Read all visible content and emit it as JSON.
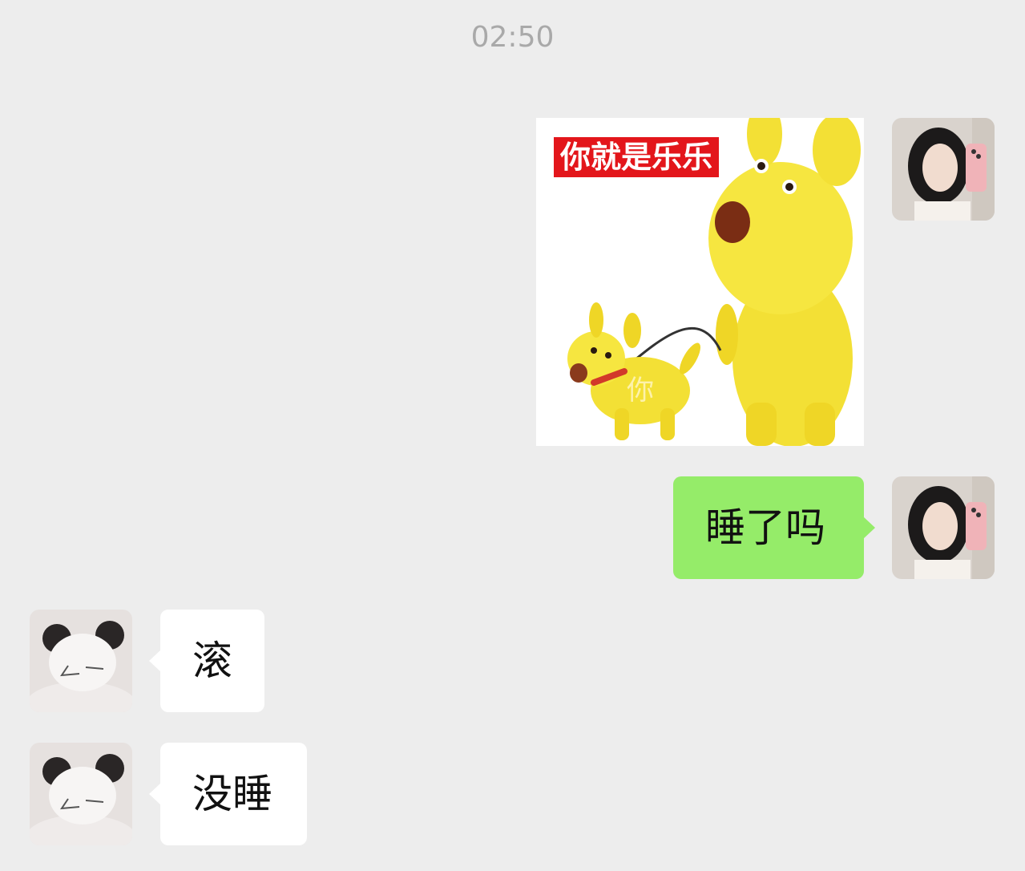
{
  "chat": {
    "timestamp": "02:50",
    "messages": [
      {
        "sender": "self",
        "type": "sticker",
        "caption": "你就是乐乐",
        "collar_text": "你"
      },
      {
        "sender": "self",
        "type": "text",
        "text": "睡了吗"
      },
      {
        "sender": "other",
        "type": "text",
        "text": "滚"
      },
      {
        "sender": "other",
        "type": "text",
        "text": "没睡"
      }
    ]
  },
  "colors": {
    "background": "#ededed",
    "outgoing_bubble": "#95ec69",
    "incoming_bubble": "#ffffff",
    "timestamp_text": "#a9a9a9",
    "sticker_caption_bg": "#e3161b"
  }
}
